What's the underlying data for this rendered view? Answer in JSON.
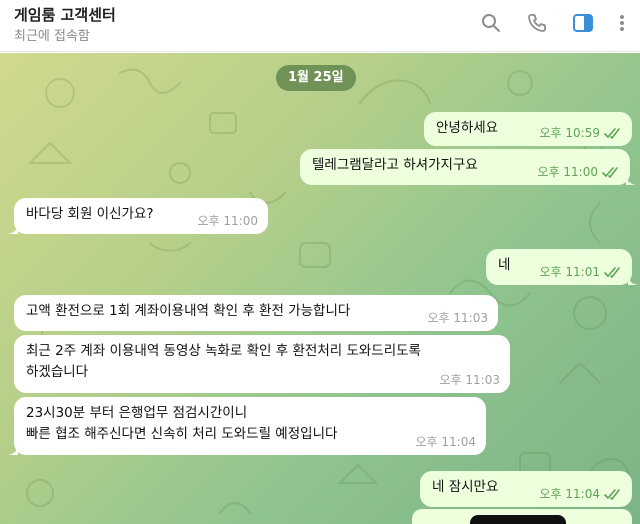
{
  "header": {
    "title": "게임룸 고객센터",
    "status": "최근에 접속함",
    "icons": [
      "search-icon",
      "phone-icon",
      "sidebar-toggle-icon",
      "more-icon"
    ],
    "accent": "#3a8fd6"
  },
  "chat": {
    "date": "1월 25일",
    "messages": [
      {
        "dir": "out",
        "text": "안녕하세요",
        "time": "오후 10:59",
        "read": true
      },
      {
        "dir": "out",
        "text": "텔레그램달라고 하셔가지구요",
        "time": "오후 11:00",
        "read": true
      },
      {
        "dir": "in",
        "text": "바다당 회원 이신가요?",
        "time": "오후 11:00"
      },
      {
        "dir": "out",
        "text": "네",
        "time": "오후 11:01",
        "read": true
      },
      {
        "dir": "in",
        "text": "고액 환전으로 1회 계좌이용내역 확인 후 환전 가능합니다",
        "time": "오후 11:03"
      },
      {
        "dir": "in",
        "text": "최근 2주 계좌 이용내역 동영상 녹화로 확인 후 환전처리 도와드리도록\n하겠습니다",
        "time": "오후 11:03"
      },
      {
        "dir": "in",
        "text": "23시30분 부터 은행업무 점검시간이니\n빠른 협조 해주신다면 신속히 처리 도와드릴 예정입니다",
        "time": "오후 11:04"
      },
      {
        "dir": "out",
        "text": "네 잠시만요",
        "time": "오후 11:04",
        "read": true
      }
    ]
  },
  "colors": {
    "outgoing_bubble": "#eeffde",
    "incoming_bubble": "#ffffff",
    "read_check": "#5ea356",
    "date_pill": "#547a42"
  }
}
